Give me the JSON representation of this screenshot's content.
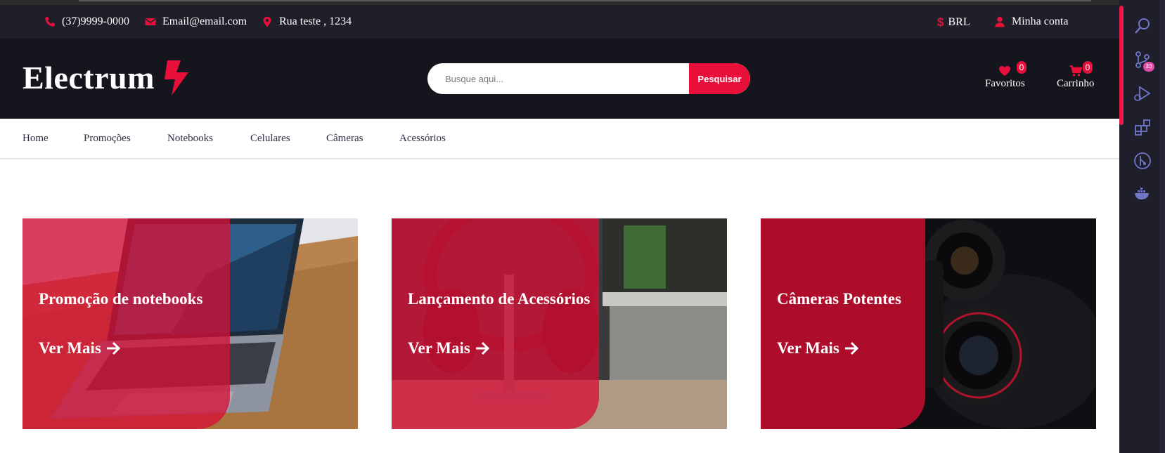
{
  "colors": {
    "accent": "#e8103a",
    "topbar_bg": "#1e1f29",
    "header_bg": "#15161d",
    "overlay": "#d61036",
    "nav_text": "#2b2d42",
    "activity_bg": "#1f1f2c"
  },
  "topbar": {
    "phone": "(37)9999-0000",
    "email": "Email@email.com",
    "address": "Rua teste , 1234",
    "currency": "BRL",
    "account": "Minha conta",
    "icons": [
      "phone-icon",
      "envelope-icon",
      "map-marker-icon",
      "dollar-icon",
      "user-icon"
    ]
  },
  "header": {
    "logo": "Electrum",
    "search": {
      "placeholder": "Busque aqui...",
      "button": "Pesquisar"
    },
    "favorites": {
      "label": "Favoritos",
      "count": "0"
    },
    "cart": {
      "label": "Carrinho",
      "count": "0"
    }
  },
  "nav": {
    "items": [
      "Home",
      "Promoções",
      "Notebooks",
      "Celulares",
      "Câmeras",
      "Acessórios"
    ]
  },
  "banners": [
    {
      "title": "Promoção de notebooks",
      "cta": "Ver Mais",
      "image": "laptop-photo"
    },
    {
      "title": "Lançamento de Acessórios",
      "cta": "Ver Mais",
      "image": "headphones-photo"
    },
    {
      "title": "Câmeras Potentes",
      "cta": "Ver Mais",
      "image": "camera-lens-photo"
    }
  ],
  "activity_bar": {
    "icons": [
      "search-icon",
      "source-control-icon",
      "run-debug-icon",
      "extensions-icon",
      "git-graph-icon",
      "docker-icon"
    ],
    "source_control_badge": "33"
  }
}
